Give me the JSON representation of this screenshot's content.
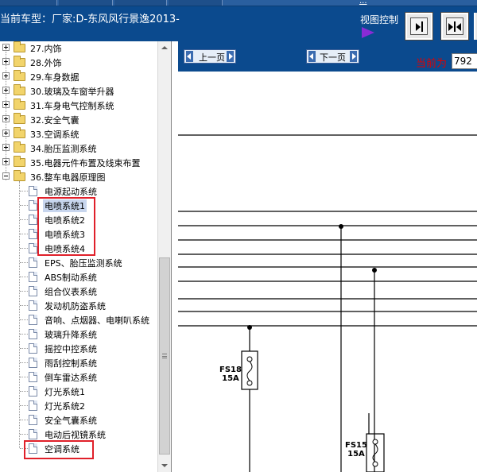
{
  "header": {
    "vehicle_title": "当前车型：厂家:D-东风风行景逸2013-",
    "top_link": "...",
    "view_control_label": "视图控制",
    "view_buttons": [
      "fit-width-icon",
      "fit-page-icon"
    ]
  },
  "tree": {
    "folders": [
      {
        "label": "27.内饰",
        "expanded": false
      },
      {
        "label": "28.外饰",
        "expanded": false
      },
      {
        "label": "29.车身数据",
        "expanded": false
      },
      {
        "label": "30.玻璃及车窗举升器",
        "expanded": false
      },
      {
        "label": "31.车身电气控制系统",
        "expanded": false
      },
      {
        "label": "32.安全气囊",
        "expanded": false
      },
      {
        "label": "33.空调系统",
        "expanded": false
      },
      {
        "label": "34.胎压监测系统",
        "expanded": false
      },
      {
        "label": "35.电器元件布置及线束布置",
        "expanded": false
      },
      {
        "label": "36.整车电器原理图",
        "expanded": true
      }
    ],
    "documents": [
      {
        "label": "电源起动系统",
        "selected": false
      },
      {
        "label": "电喷系统1",
        "selected": true
      },
      {
        "label": "电喷系统2",
        "selected": false
      },
      {
        "label": "电喷系统3",
        "selected": false
      },
      {
        "label": "电喷系统4",
        "selected": false
      },
      {
        "label": "EPS、胎压监测系统",
        "selected": false
      },
      {
        "label": "ABS制动系统",
        "selected": false
      },
      {
        "label": "组合仪表系统",
        "selected": false
      },
      {
        "label": "发动机防盗系统",
        "selected": false
      },
      {
        "label": "音响、点烟器、电喇叭系统",
        "selected": false
      },
      {
        "label": "玻璃升降系统",
        "selected": false
      },
      {
        "label": "摇控中控系统",
        "selected": false
      },
      {
        "label": "雨刮控制系统",
        "selected": false
      },
      {
        "label": "倒车雷达系统",
        "selected": false
      },
      {
        "label": "灯光系统1",
        "selected": false
      },
      {
        "label": "灯光系统2",
        "selected": false
      },
      {
        "label": "安全气囊系统",
        "selected": false
      },
      {
        "label": "电动后视镜系统",
        "selected": false
      },
      {
        "label": "空调系统",
        "selected": false
      }
    ],
    "highlight_color": "#e0202a"
  },
  "pager": {
    "prev_label": "上一页",
    "next_label": "下一页",
    "current_label": "当前为",
    "current_page": "792"
  },
  "diagram": {
    "fuses": [
      {
        "name": "FS18",
        "rating": "15A"
      },
      {
        "name": "FS15",
        "rating": "15A"
      }
    ]
  },
  "colors": {
    "header_bg": "#0b4a8e",
    "current_label": "#e00000",
    "view_arrow": "#8a2bd6"
  }
}
